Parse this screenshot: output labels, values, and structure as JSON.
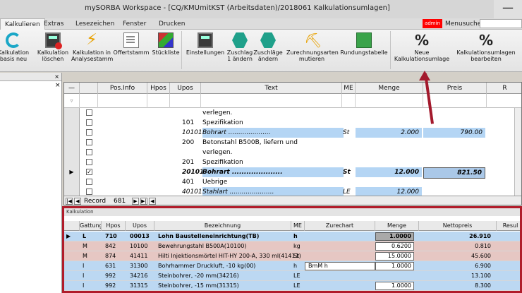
{
  "window": {
    "title": "mySORBA Workspace - [CQ/KMUmitKST (Arbeitsdaten)/2018061 Kalkulationsumlagen]",
    "minimize_glyph": "—"
  },
  "menu": {
    "tabs": [
      "Kalkulieren",
      "Extras",
      "Lesezeichen",
      "Fenster",
      "Drucken"
    ],
    "admin": "admin",
    "search_label": "Menusuche"
  },
  "ribbon": {
    "buttons": [
      {
        "label1": "Kalkulation",
        "label2": "basis neu",
        "icon": "cycle-icon"
      },
      {
        "label1": "Kalkulation",
        "label2": "löschen",
        "icon": "calculator-delete-icon"
      },
      {
        "label1": "Kalkulation in",
        "label2": "Analysestamm",
        "icon": "lightning-icon"
      },
      {
        "label1": "Offertstamm",
        "label2": "",
        "icon": "document-icon"
      },
      {
        "label1": "Stückliste",
        "label2": "",
        "icon": "list-icon"
      },
      {
        "label1": "Einstellungen",
        "label2": "",
        "icon": "calculator-icon"
      },
      {
        "label1": "Zuschlag",
        "label2": "1 ändern",
        "icon": "surcharge-icon"
      },
      {
        "label1": "Zuschläge",
        "label2": "ändern",
        "icon": "surcharges-icon"
      },
      {
        "label1": "Zurechnungsarten",
        "label2": "mutieren",
        "icon": "excavator-icon"
      },
      {
        "label1": "Rundungstabelle",
        "label2": "",
        "icon": "rounding-table-icon"
      },
      {
        "label1": "Neue",
        "label2": "Kalkulationsumlage",
        "icon": "percent-icon"
      },
      {
        "label1": "Kalkulationsumlagen",
        "label2": "bearbeiten",
        "icon": "percent-edit-icon"
      }
    ]
  },
  "leftpane": {
    "close": "×"
  },
  "grid": {
    "close": "×",
    "columns": [
      "Pos.Info",
      "Hpos",
      "Upos",
      "Text",
      "ME",
      "Menge",
      "Preis",
      "R"
    ],
    "filter_icon": "▿",
    "rows": [
      {
        "upos": "",
        "text": "verlegen.",
        "me": "",
        "menge": "",
        "preis": "",
        "style": "plain",
        "cb": "",
        "ptr": ""
      },
      {
        "upos": "101",
        "text": "Spezifikation",
        "me": "",
        "menge": "",
        "preis": "",
        "style": "plain",
        "cb": "",
        "ptr": ""
      },
      {
        "upos": "10101",
        "text": "Bohrart .....................",
        "me": "St",
        "menge": "2.000",
        "preis": "790.00",
        "style": "blue ital",
        "cb": "",
        "ptr": ""
      },
      {
        "upos": "200",
        "text": "Betonstahl B500B, liefern und",
        "me": "",
        "menge": "",
        "preis": "",
        "style": "plain",
        "cb": "",
        "ptr": ""
      },
      {
        "upos": "",
        "text": "verlegen.",
        "me": "",
        "menge": "",
        "preis": "",
        "style": "plain",
        "cb": "",
        "ptr": ""
      },
      {
        "upos": "201",
        "text": "Spezifikation",
        "me": "",
        "menge": "",
        "preis": "",
        "style": "plain",
        "cb": "",
        "ptr": ""
      },
      {
        "upos": "20101",
        "text": "Bohrart .....................",
        "me": "St",
        "menge": "12.000",
        "preis": "821.50",
        "style": "blue ital bold sel",
        "cb": "✓",
        "ptr": "▶"
      },
      {
        "upos": "401",
        "text": "Uebrige",
        "me": "",
        "menge": "",
        "preis": "",
        "style": "plain",
        "cb": "",
        "ptr": ""
      },
      {
        "upos": "40101",
        "text": "Stahlart ......................",
        "me": "LE",
        "menge": "12.000",
        "preis": "",
        "style": "blue ital",
        "cb": "",
        "ptr": ""
      }
    ],
    "nav": {
      "record_label": "Record",
      "record_value": "681"
    }
  },
  "kalkulation": {
    "title": "Kalkulation",
    "columns": [
      "Gattung",
      "Hpos",
      "Upos",
      "Bezeichnung",
      "ME",
      "Zurechart",
      "Menge",
      "Nettopreis",
      "Resul"
    ],
    "rows": [
      {
        "ptr": "▶",
        "gattung": "L",
        "hpos": "710",
        "upos": "00013",
        "bez": "Lohn Baustelleneinrichtung(TB)",
        "me": "h",
        "zur": "",
        "menge": "1.0000",
        "netto": "26.910",
        "style": "blue b",
        "mstyle": "mgray"
      },
      {
        "ptr": "",
        "gattung": "M",
        "hpos": "842",
        "upos": "10100",
        "bez": "Bewehrungstahl B500A(10100)",
        "me": "kg",
        "zur": "",
        "menge": "0.6200",
        "netto": "0.810",
        "style": "pink",
        "mstyle": "mbox"
      },
      {
        "ptr": "",
        "gattung": "M",
        "hpos": "874",
        "upos": "41411",
        "bez": "Hilti Injektionsmörtel HIT-HY 200-A, 330 ml(41411)",
        "me": "St",
        "zur": "",
        "menge": "15.0000",
        "netto": "45.600",
        "style": "pink",
        "mstyle": "mbox"
      },
      {
        "ptr": "",
        "gattung": "I",
        "hpos": "631",
        "upos": "31300",
        "bez": "Bohrhammer Druckluft, -10 kg(00)",
        "me": "h",
        "zur": "BmM     h",
        "menge": "1.0000",
        "netto": "6.900",
        "style": "blue",
        "mstyle": "mbox"
      },
      {
        "ptr": "",
        "gattung": "I",
        "hpos": "992",
        "upos": "34216",
        "bez": "Steinbohrer, -20 mm(34216)",
        "me": "LE",
        "zur": "",
        "menge": "",
        "netto": "13.100",
        "style": "blue",
        "mstyle": ""
      },
      {
        "ptr": "",
        "gattung": "I",
        "hpos": "992",
        "upos": "31315",
        "bez": "Steinbohrer, -15 mm(31315)",
        "me": "LE",
        "zur": "",
        "menge": "1.0000",
        "netto": "8.300",
        "style": "blue",
        "mstyle": "mbox"
      }
    ]
  },
  "colors": {
    "annotation": "#a3192c",
    "admin_bg": "#ff0000",
    "highlight_blue": "#b4d5f4",
    "material_pink": "#e6c7c3"
  }
}
